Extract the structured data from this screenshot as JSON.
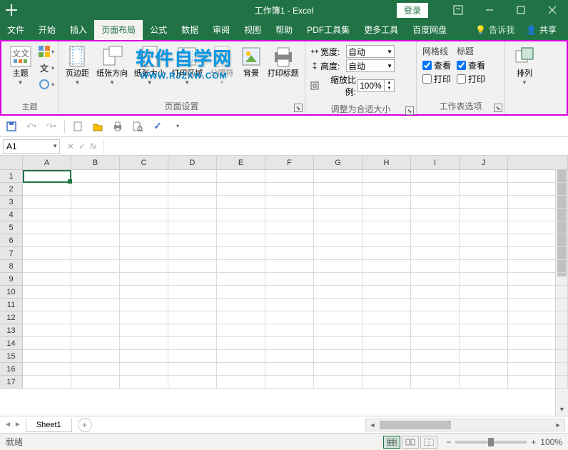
{
  "title": "工作簿1 - Excel",
  "login": "登录",
  "menus": {
    "file": "文件",
    "home": "开始",
    "insert": "插入",
    "layout": "页面布局",
    "formula": "公式",
    "data": "数据",
    "review": "审阅",
    "view": "视图",
    "help": "帮助",
    "pdf": "PDF工具集",
    "more": "更多工具",
    "baidu": "百度网盘",
    "tell": "告诉我",
    "share": "共享"
  },
  "ribbon": {
    "theme": {
      "main": "主题",
      "group": "主题"
    },
    "page": {
      "margins": "页边距",
      "orient": "纸张方向",
      "size": "纸张大小",
      "area": "打印区域",
      "breaks": "分隔符",
      "bg": "背景",
      "titles": "打印标题",
      "group": "页面设置"
    },
    "scale": {
      "width": "宽度:",
      "height": "高度:",
      "ratio": "缩放比例:",
      "auto": "自动",
      "pct": "100%",
      "group": "调整为合适大小"
    },
    "sheet": {
      "grid": "网格线",
      "head": "标题",
      "view": "查看",
      "print": "打印",
      "group": "工作表选项"
    },
    "arrange": {
      "main": "排列"
    }
  },
  "namebox": "A1",
  "sheet": "Sheet1",
  "status": "就绪",
  "zoom": "100%",
  "cols": [
    "A",
    "B",
    "C",
    "D",
    "E",
    "F",
    "G",
    "H",
    "I",
    "J"
  ],
  "rows": [
    "1",
    "2",
    "3",
    "4",
    "5",
    "6",
    "7",
    "8",
    "9",
    "10",
    "11",
    "12",
    "13",
    "14",
    "15",
    "16",
    "17"
  ],
  "watermark": {
    "main": "软件自学网",
    "sub": "WWW.RJZXW.COM"
  }
}
